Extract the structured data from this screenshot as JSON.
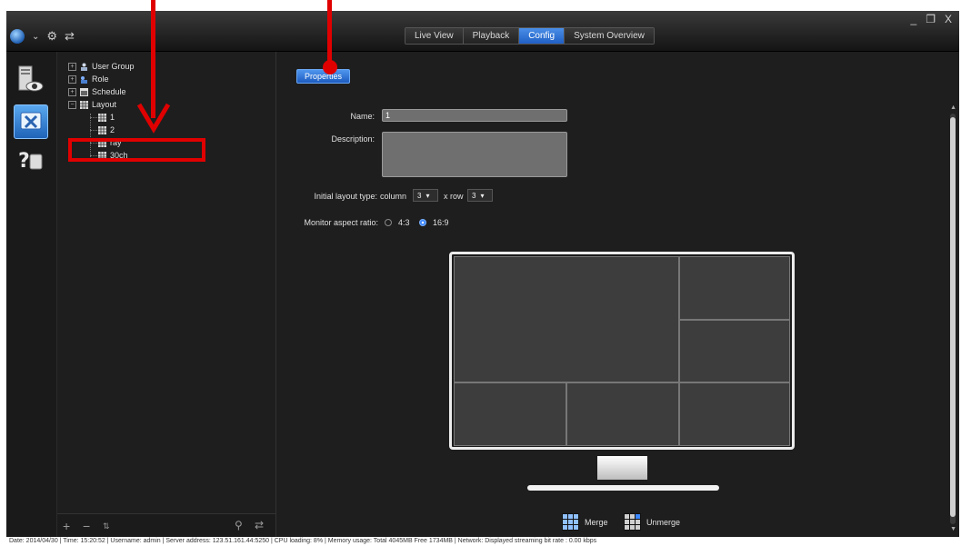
{
  "window": {
    "controls": [
      "_",
      "❐",
      "X"
    ]
  },
  "top_tabs": [
    {
      "label": "Live View",
      "active": false
    },
    {
      "label": "Playback",
      "active": false
    },
    {
      "label": "Config",
      "active": true
    },
    {
      "label": "System Overview",
      "active": false
    }
  ],
  "tree": {
    "items": [
      {
        "label": "User Group",
        "icon": "user-group-icon"
      },
      {
        "label": "Role",
        "icon": "role-icon"
      },
      {
        "label": "Schedule",
        "icon": "schedule-icon"
      },
      {
        "label": "Layout",
        "icon": "layout-icon"
      }
    ],
    "layout_children": [
      {
        "label": "1",
        "icon": "layout-grid-icon"
      },
      {
        "label": "2",
        "icon": "layout-grid-icon"
      },
      {
        "label": "ray",
        "icon": "layout-grid-icon"
      },
      {
        "label": "30ch",
        "icon": "layout-grid-icon"
      }
    ]
  },
  "properties": {
    "button_label": "Properties",
    "name_label": "Name:",
    "name_value": "1",
    "description_label": "Description:",
    "description_value": "",
    "layout_type_label": "Initial layout type:",
    "column_label": "column",
    "column_value": "3",
    "row_label": "x row",
    "row_value": "3",
    "aspect_label": "Monitor aspect ratio:",
    "aspect_options": [
      "4:3",
      "16:9"
    ],
    "aspect_selected": "16:9"
  },
  "merge": {
    "merge_label": "Merge",
    "unmerge_label": "Unmerge"
  },
  "status": {
    "text": "Date: 2014/04/30  |  Time: 15:20:52  |  Username: admin  |  Server address: 123.51.161.44:5250  |  CPU loading: 8%  |  Memory usage: Total 4045MB  Free 1734MB  |  Network: Displayed streaming bit rate  :  0.00 kbps"
  },
  "colors": {
    "accent": "#2f74d8",
    "annotation": "#e00000"
  }
}
